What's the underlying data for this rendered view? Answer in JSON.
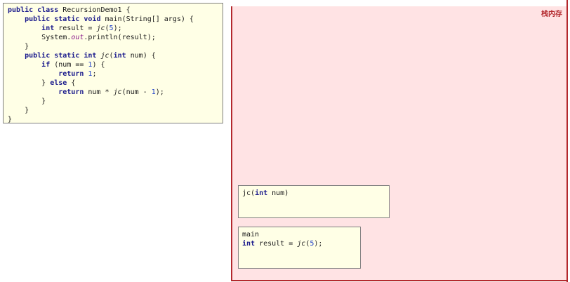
{
  "code": {
    "line1": {
      "a": "public class",
      "b": " RecursionDemo1 {"
    },
    "line2": {
      "indent": "    ",
      "a": "public static void",
      "b": " main(String[] args) {"
    },
    "line3": {
      "indent": "        ",
      "a": "int",
      "b": " result = ",
      "c": "jc",
      "d": "(",
      "e": "5",
      "f": ");"
    },
    "line4": {
      "indent": "        ",
      "a": "System.",
      "b": "out",
      "c": ".println(result);"
    },
    "line5": {
      "text": "    }"
    },
    "line6": {
      "indent": "    ",
      "a": "public static int",
      "b": " ",
      "c": "jc",
      "d": "(",
      "e": "int",
      "f": " num) {"
    },
    "line7": {
      "indent": "        ",
      "a": "if",
      "b": " (num == ",
      "c": "1",
      "d": ") {"
    },
    "line8": {
      "indent": "            ",
      "a": "return",
      "b": " ",
      "c": "1",
      "d": ";"
    },
    "line9": {
      "indent": "        ",
      "a": "} ",
      "b": "else",
      "c": " {"
    },
    "line10": {
      "indent": "            ",
      "a": "return",
      "b": " num * ",
      "c": "jc",
      "d": "(num - ",
      "e": "1",
      "f": ");"
    },
    "line11": {
      "text": "        }"
    },
    "line12": {
      "text": "    }"
    },
    "line13": {
      "text": "}"
    }
  },
  "stack": {
    "label": "栈内存",
    "frame_jc": {
      "a": "jc(",
      "b": "int",
      "c": " num)"
    },
    "frame_main": {
      "title": "main",
      "a": "int",
      "b": " result = ",
      "c": "jc",
      "d": "(",
      "e": "5",
      "f": ");"
    }
  },
  "colors": {
    "code_bg": "#ffffe6",
    "stack_bg": "#ffe3e4",
    "stack_border": "#b3282d",
    "keyword": "#1a1a8c",
    "number": "#1a3cc8"
  }
}
